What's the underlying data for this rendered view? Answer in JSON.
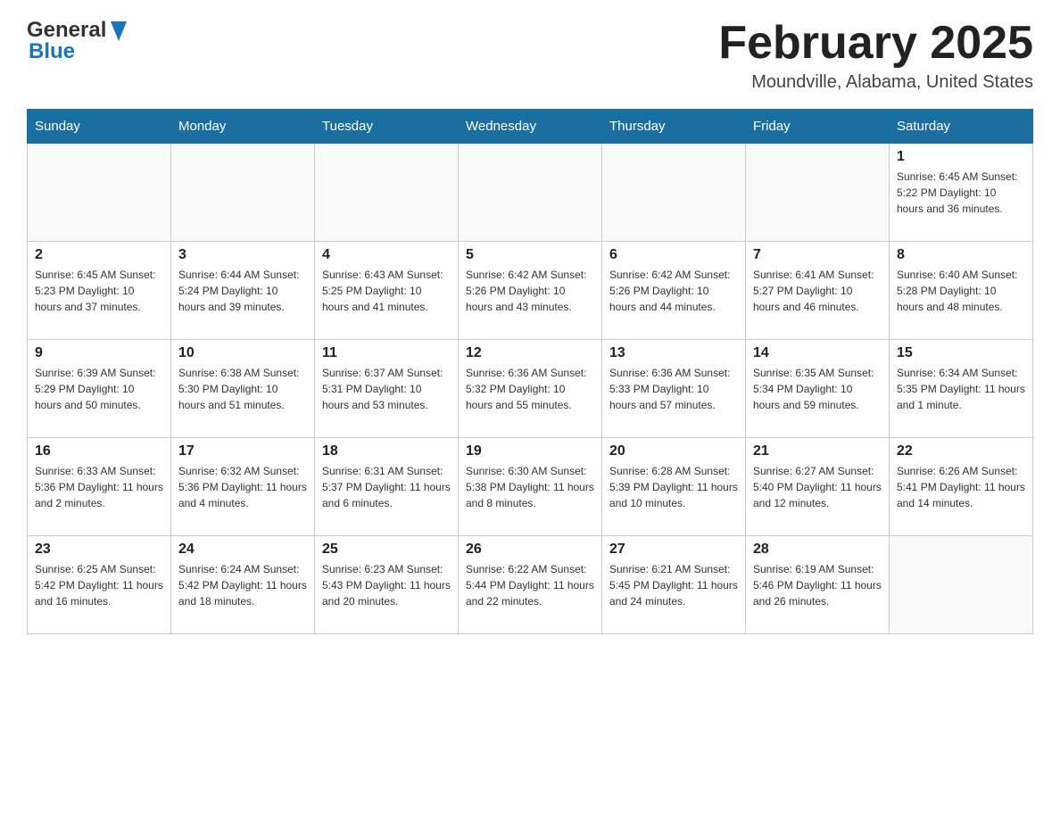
{
  "header": {
    "logo_general": "General",
    "logo_blue": "Blue",
    "month_title": "February 2025",
    "location": "Moundville, Alabama, United States"
  },
  "days_of_week": [
    "Sunday",
    "Monday",
    "Tuesday",
    "Wednesday",
    "Thursday",
    "Friday",
    "Saturday"
  ],
  "weeks": [
    [
      {
        "day": "",
        "info": ""
      },
      {
        "day": "",
        "info": ""
      },
      {
        "day": "",
        "info": ""
      },
      {
        "day": "",
        "info": ""
      },
      {
        "day": "",
        "info": ""
      },
      {
        "day": "",
        "info": ""
      },
      {
        "day": "1",
        "info": "Sunrise: 6:45 AM\nSunset: 5:22 PM\nDaylight: 10 hours and 36 minutes."
      }
    ],
    [
      {
        "day": "2",
        "info": "Sunrise: 6:45 AM\nSunset: 5:23 PM\nDaylight: 10 hours and 37 minutes."
      },
      {
        "day": "3",
        "info": "Sunrise: 6:44 AM\nSunset: 5:24 PM\nDaylight: 10 hours and 39 minutes."
      },
      {
        "day": "4",
        "info": "Sunrise: 6:43 AM\nSunset: 5:25 PM\nDaylight: 10 hours and 41 minutes."
      },
      {
        "day": "5",
        "info": "Sunrise: 6:42 AM\nSunset: 5:26 PM\nDaylight: 10 hours and 43 minutes."
      },
      {
        "day": "6",
        "info": "Sunrise: 6:42 AM\nSunset: 5:26 PM\nDaylight: 10 hours and 44 minutes."
      },
      {
        "day": "7",
        "info": "Sunrise: 6:41 AM\nSunset: 5:27 PM\nDaylight: 10 hours and 46 minutes."
      },
      {
        "day": "8",
        "info": "Sunrise: 6:40 AM\nSunset: 5:28 PM\nDaylight: 10 hours and 48 minutes."
      }
    ],
    [
      {
        "day": "9",
        "info": "Sunrise: 6:39 AM\nSunset: 5:29 PM\nDaylight: 10 hours and 50 minutes."
      },
      {
        "day": "10",
        "info": "Sunrise: 6:38 AM\nSunset: 5:30 PM\nDaylight: 10 hours and 51 minutes."
      },
      {
        "day": "11",
        "info": "Sunrise: 6:37 AM\nSunset: 5:31 PM\nDaylight: 10 hours and 53 minutes."
      },
      {
        "day": "12",
        "info": "Sunrise: 6:36 AM\nSunset: 5:32 PM\nDaylight: 10 hours and 55 minutes."
      },
      {
        "day": "13",
        "info": "Sunrise: 6:36 AM\nSunset: 5:33 PM\nDaylight: 10 hours and 57 minutes."
      },
      {
        "day": "14",
        "info": "Sunrise: 6:35 AM\nSunset: 5:34 PM\nDaylight: 10 hours and 59 minutes."
      },
      {
        "day": "15",
        "info": "Sunrise: 6:34 AM\nSunset: 5:35 PM\nDaylight: 11 hours and 1 minute."
      }
    ],
    [
      {
        "day": "16",
        "info": "Sunrise: 6:33 AM\nSunset: 5:36 PM\nDaylight: 11 hours and 2 minutes."
      },
      {
        "day": "17",
        "info": "Sunrise: 6:32 AM\nSunset: 5:36 PM\nDaylight: 11 hours and 4 minutes."
      },
      {
        "day": "18",
        "info": "Sunrise: 6:31 AM\nSunset: 5:37 PM\nDaylight: 11 hours and 6 minutes."
      },
      {
        "day": "19",
        "info": "Sunrise: 6:30 AM\nSunset: 5:38 PM\nDaylight: 11 hours and 8 minutes."
      },
      {
        "day": "20",
        "info": "Sunrise: 6:28 AM\nSunset: 5:39 PM\nDaylight: 11 hours and 10 minutes."
      },
      {
        "day": "21",
        "info": "Sunrise: 6:27 AM\nSunset: 5:40 PM\nDaylight: 11 hours and 12 minutes."
      },
      {
        "day": "22",
        "info": "Sunrise: 6:26 AM\nSunset: 5:41 PM\nDaylight: 11 hours and 14 minutes."
      }
    ],
    [
      {
        "day": "23",
        "info": "Sunrise: 6:25 AM\nSunset: 5:42 PM\nDaylight: 11 hours and 16 minutes."
      },
      {
        "day": "24",
        "info": "Sunrise: 6:24 AM\nSunset: 5:42 PM\nDaylight: 11 hours and 18 minutes."
      },
      {
        "day": "25",
        "info": "Sunrise: 6:23 AM\nSunset: 5:43 PM\nDaylight: 11 hours and 20 minutes."
      },
      {
        "day": "26",
        "info": "Sunrise: 6:22 AM\nSunset: 5:44 PM\nDaylight: 11 hours and 22 minutes."
      },
      {
        "day": "27",
        "info": "Sunrise: 6:21 AM\nSunset: 5:45 PM\nDaylight: 11 hours and 24 minutes."
      },
      {
        "day": "28",
        "info": "Sunrise: 6:19 AM\nSunset: 5:46 PM\nDaylight: 11 hours and 26 minutes."
      },
      {
        "day": "",
        "info": ""
      }
    ]
  ]
}
